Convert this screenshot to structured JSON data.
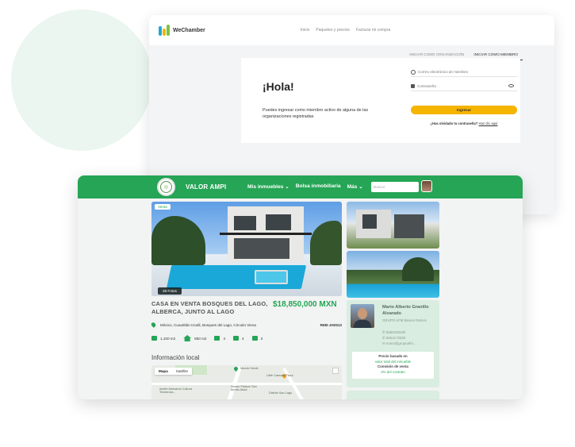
{
  "back_window": {
    "brand": "WeChamber",
    "nav": [
      "Inicio",
      "Paquetes y precios",
      "Facturar mi compra"
    ],
    "tabs": [
      "INICIAR COMO ORGANIZACIÓN",
      "INICIAR COMO MIEMBRO"
    ],
    "active_tab": "INICIAR COMO MIEMBRO",
    "greeting": "¡Hola!",
    "intro": "Puedes ingresar como miembro activo de alguna de las organizaciones registradas",
    "email_placeholder": "Correo electrónico de miembro",
    "password_placeholder": "Contraseña",
    "submit": "Ingresar",
    "forgot_q": "¿Has olvidado tu contraseña?",
    "forgot_link": "Haz clic aquí"
  },
  "front_window": {
    "brand": "VALOR",
    "brand2": "AMPI",
    "nav": [
      "Mis inmuebles",
      "Bolsa inmobiliaria",
      "Más"
    ],
    "search_placeholder": "Buscar",
    "tag_sale": "Venta",
    "photos": "28 Fotos",
    "title": "CASA EN VENTA BOSQUES DEL LAGO, ALBERCA, JUNTO AL LAGO",
    "price": "$18,850,000 MXN",
    "location": "México, Cuautitlán Izcalli, Bosques del Lago, Circuito Viena",
    "ref": "REB-JH2513",
    "specs": [
      "1,100 m2",
      "850 m2",
      "4",
      "4",
      "3"
    ],
    "info_title": "Información local",
    "map_tabs": [
      "Mapa",
      "Satélite"
    ],
    "map_labels": [
      "Mundo Verde",
      "Little Caesars Pizza",
      "Museo Palacio San Benito Abad",
      "Distrito San Lago",
      "Aceite Artesanía Cultura Tendencia..."
    ],
    "agent": {
      "name": "Mario Alberto Granillo Alvarado",
      "company": "GRUPO AFM Bienes Raíces",
      "phone1": "5556228100",
      "phone2": "5554172520",
      "email": "mario@grupoafm...",
      "box": [
        "Precio basado en",
        "valor total del inmueble",
        "Comisión de venta",
        "2% del contrato"
      ]
    }
  }
}
